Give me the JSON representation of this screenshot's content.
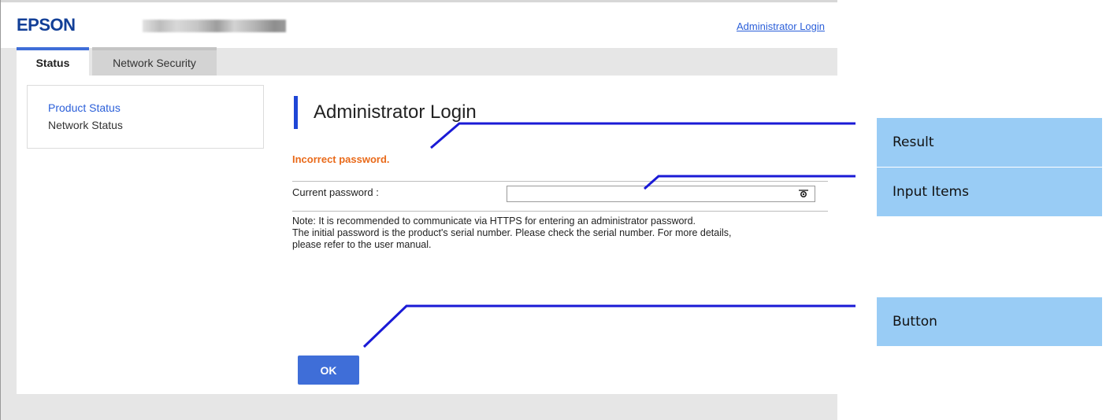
{
  "header": {
    "logo_text": "EPSON",
    "admin_login_link": "Administrator Login"
  },
  "tabs": [
    {
      "label": "Status",
      "selected": true
    },
    {
      "label": "Network Security",
      "selected": false
    }
  ],
  "sidebar": {
    "items": [
      {
        "label": "Product Status",
        "active": true
      },
      {
        "label": "Network Status",
        "active": false
      }
    ]
  },
  "main": {
    "title": "Administrator Login",
    "error_message": "Incorrect password.",
    "password_label": "Current password :",
    "password_value": "",
    "note_lines": [
      "Note: It is recommended to communicate via HTTPS for entering an administrator password.",
      "The initial password is the product's serial number. Please check the serial number. For more details,",
      "please refer to the user manual."
    ],
    "ok_label": "OK"
  },
  "callouts": {
    "result": "Result",
    "input_items": "Input Items",
    "button": "Button"
  },
  "colors": {
    "brand_blue": "#123f97",
    "accent_blue": "#3f6ed8",
    "heading_bar": "#1f46d6",
    "error_orange": "#e96a1a",
    "callout_bg": "#99ccf5",
    "leader_line": "#1a1ad6"
  },
  "icons": {
    "password_toggle": "eye-icon",
    "blurred_device_name": "redacted-device-name"
  }
}
